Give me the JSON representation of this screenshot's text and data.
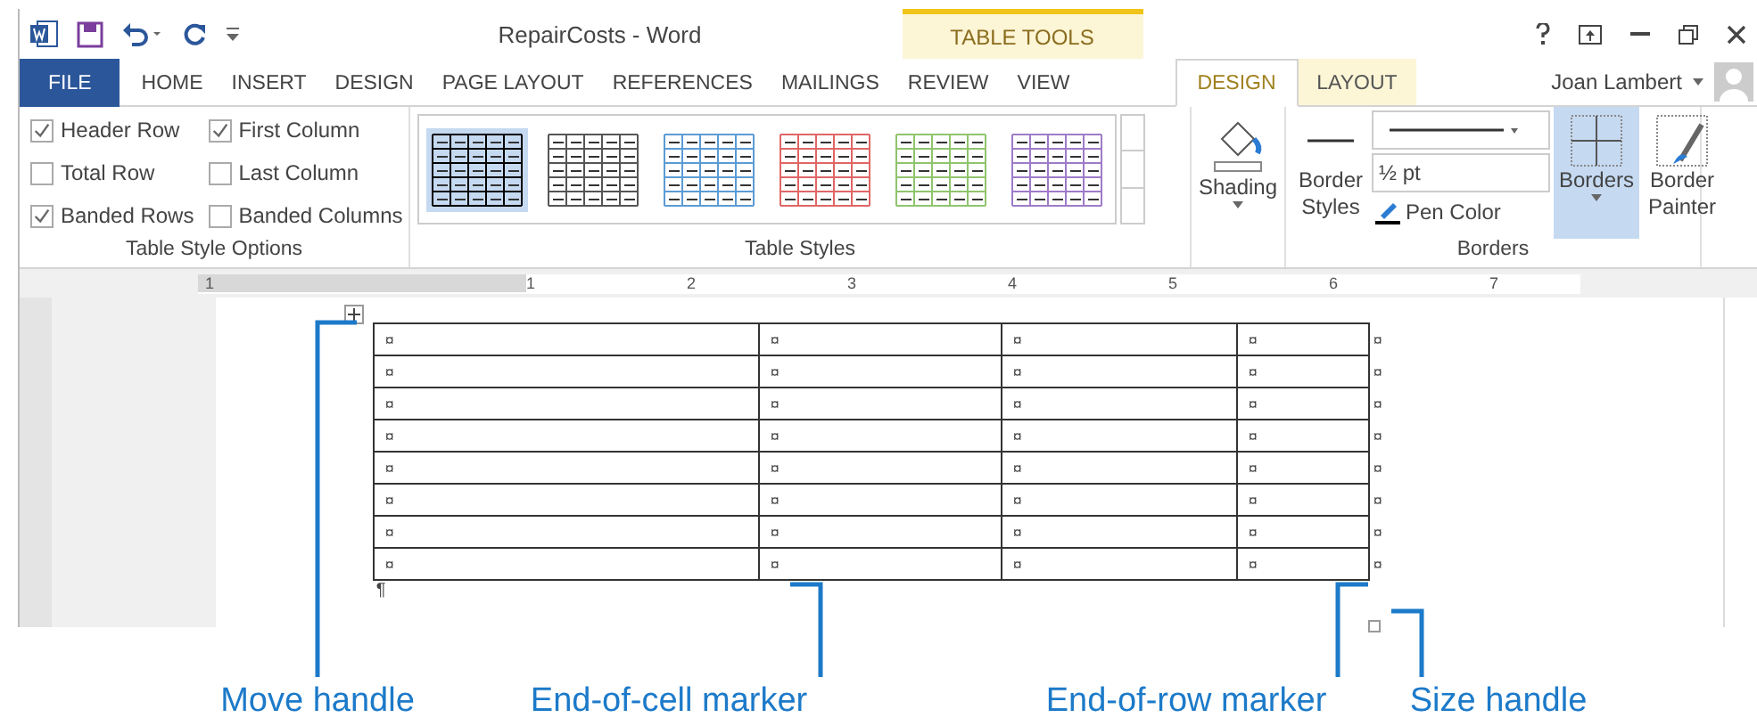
{
  "window": {
    "title": "RepairCosts - Word",
    "contextual_group": "TABLE TOOLS",
    "user": "Joan Lambert"
  },
  "tabs": [
    {
      "label": "FILE",
      "kind": "file",
      "selected": false
    },
    {
      "label": "HOME",
      "kind": "main",
      "selected": false
    },
    {
      "label": "INSERT",
      "kind": "main",
      "selected": false
    },
    {
      "label": "DESIGN",
      "kind": "main",
      "selected": false
    },
    {
      "label": "PAGE LAYOUT",
      "kind": "main",
      "selected": false
    },
    {
      "label": "REFERENCES",
      "kind": "main",
      "selected": false
    },
    {
      "label": "MAILINGS",
      "kind": "main",
      "selected": false
    },
    {
      "label": "REVIEW",
      "kind": "main",
      "selected": false
    },
    {
      "label": "VIEW",
      "kind": "main",
      "selected": false
    },
    {
      "label": "DESIGN",
      "kind": "contextual",
      "selected": true
    },
    {
      "label": "LAYOUT",
      "kind": "contextual",
      "selected": false
    }
  ],
  "ribbon": {
    "table_style_options": {
      "label": "Table Style Options",
      "options": [
        {
          "label": "Header Row",
          "checked": true
        },
        {
          "label": "First Column",
          "checked": true
        },
        {
          "label": "Total Row",
          "checked": false
        },
        {
          "label": "Last Column",
          "checked": false
        },
        {
          "label": "Banded Rows",
          "checked": true
        },
        {
          "label": "Banded Columns",
          "checked": false
        }
      ]
    },
    "table_styles": {
      "label": "Table Styles",
      "styles": [
        {
          "color": "#000000",
          "selected": true
        },
        {
          "color": "#555555",
          "selected": false
        },
        {
          "color": "#5b9bd5",
          "selected": false
        },
        {
          "color": "#e06666",
          "selected": false
        },
        {
          "color": "#8fc46d",
          "selected": false
        },
        {
          "color": "#9e7bc8",
          "selected": false
        }
      ]
    },
    "shading": {
      "label": "Shading"
    },
    "borders": {
      "label": "Borders",
      "border_styles": "Border Styles",
      "line_weight": "½ pt",
      "pen_color": "Pen Color",
      "borders_button": {
        "label": "Borders",
        "selected": true
      },
      "border_painter": "Border Painter"
    }
  },
  "ruler": {
    "labels": [
      "1",
      "1",
      "2",
      "3",
      "4",
      "5",
      "6",
      "7"
    ]
  },
  "document": {
    "table": {
      "rows": [
        {
          "cells": [
            "¤",
            "¤",
            "¤",
            "¤"
          ],
          "end_marker": "¤"
        },
        {
          "cells": [
            "¤",
            "¤",
            "¤",
            "¤"
          ],
          "end_marker": "¤"
        },
        {
          "cells": [
            "¤",
            "¤",
            "¤",
            "¤"
          ],
          "end_marker": "¤"
        },
        {
          "cells": [
            "¤",
            "¤",
            "¤",
            "¤"
          ],
          "end_marker": "¤"
        },
        {
          "cells": [
            "¤",
            "¤",
            "¤",
            "¤"
          ],
          "end_marker": "¤"
        },
        {
          "cells": [
            "¤",
            "¤",
            "¤",
            "¤"
          ],
          "end_marker": "¤"
        },
        {
          "cells": [
            "¤",
            "¤",
            "¤",
            "¤"
          ],
          "end_marker": "¤"
        },
        {
          "cells": [
            "¤",
            "¤",
            "¤",
            "¤"
          ],
          "end_marker": "¤"
        }
      ]
    },
    "paragraph_mark": "¶"
  },
  "callouts": [
    {
      "label": "Move handle"
    },
    {
      "label": "End-of-cell marker"
    },
    {
      "label": "End-of-row marker"
    },
    {
      "label": "Size handle"
    }
  ]
}
